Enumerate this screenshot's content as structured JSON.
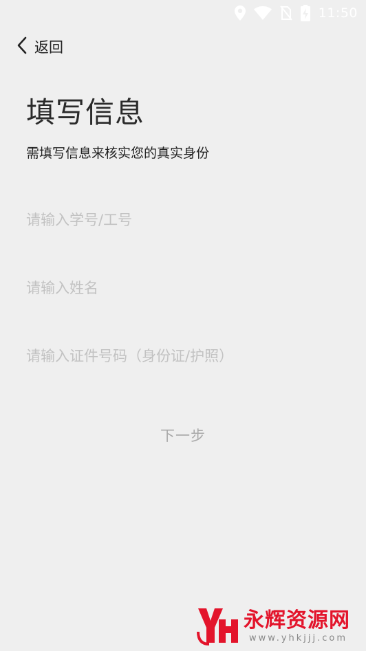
{
  "status_bar": {
    "time": "11:50",
    "icons": [
      "location-icon",
      "wifi-icon",
      "no-sim-icon",
      "battery-charging-icon"
    ]
  },
  "nav": {
    "back_label": "返回"
  },
  "page": {
    "title": "填写信息",
    "subtitle": "需填写信息来核实您的真实身份"
  },
  "form": {
    "student_id": {
      "value": "",
      "placeholder": "请输入学号/工号"
    },
    "name": {
      "value": "",
      "placeholder": "请输入姓名"
    },
    "id_number": {
      "value": "",
      "placeholder": "请输入证件号码（身份证/护照）"
    },
    "next_label": "下一步"
  },
  "watermark": {
    "brand": "永辉资源网",
    "url": "www.yhkjjj.com"
  },
  "colors": {
    "background": "#efefef",
    "placeholder": "#c2c2c2",
    "disabled_button": "#a9a9a9",
    "watermark_red": "#e3142b"
  }
}
